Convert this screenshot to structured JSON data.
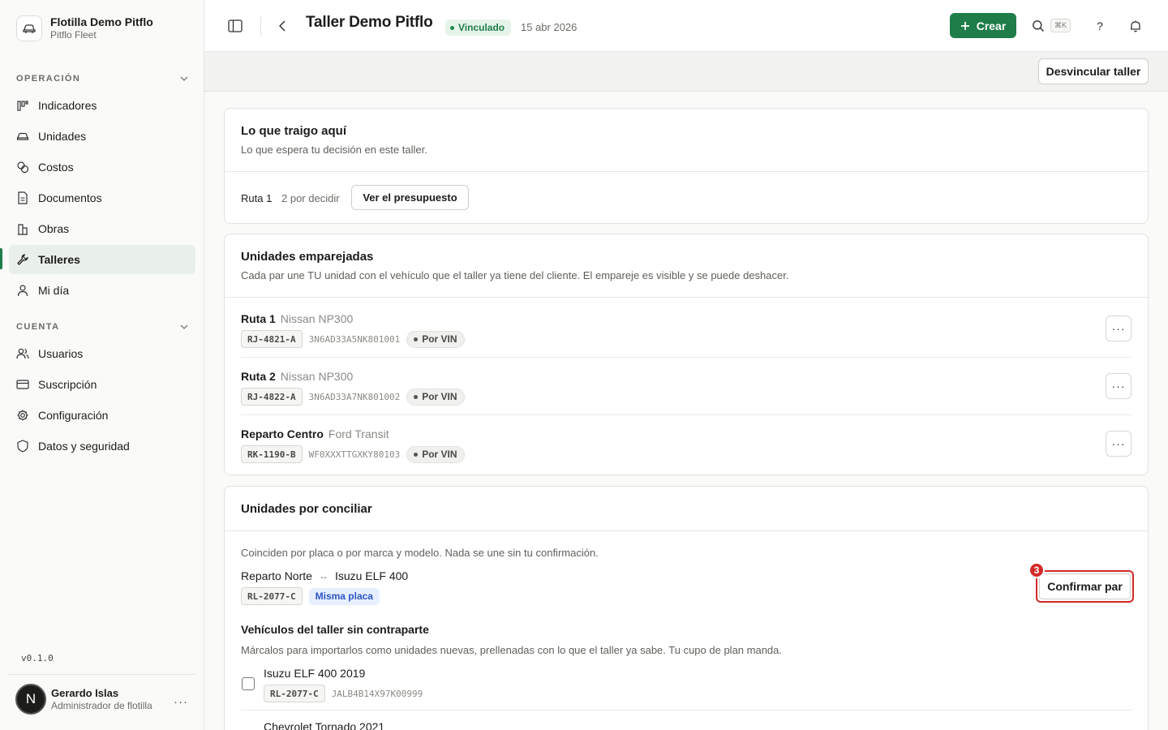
{
  "org": {
    "name": "Flotilla Demo Pitflo",
    "subtitle": "Pitflo Fleet",
    "icon": "car-icon"
  },
  "sidebar": {
    "sections": [
      {
        "label": "OPERACIÓN",
        "items": [
          {
            "label": "Indicadores",
            "icon": "chart-columns-icon"
          },
          {
            "label": "Unidades",
            "icon": "car-icon"
          },
          {
            "label": "Costos",
            "icon": "coins-icon"
          },
          {
            "label": "Documentos",
            "icon": "document-icon"
          },
          {
            "label": "Obras",
            "icon": "building-icon"
          },
          {
            "label": "Talleres",
            "icon": "wrench-icon",
            "active": true
          },
          {
            "label": "Mi día",
            "icon": "user-icon"
          }
        ]
      },
      {
        "label": "CUENTA",
        "items": [
          {
            "label": "Usuarios",
            "icon": "users-icon"
          },
          {
            "label": "Suscripción",
            "icon": "credit-card-icon"
          },
          {
            "label": "Configuración",
            "icon": "gear-icon"
          },
          {
            "label": "Datos y seguridad",
            "icon": "shield-icon"
          }
        ]
      }
    ],
    "version": "v0.1.0",
    "user": {
      "initial": "N",
      "name": "Gerardo Islas",
      "role": "Administrador de flotilla"
    }
  },
  "topbar": {
    "title": "Taller Demo Pitflo",
    "status": "Vinculado",
    "date": "15 abr 2026",
    "create_label": "Crear",
    "shortcut": "⌘K",
    "help": "?"
  },
  "toolbar": {
    "unlink_label": "Desvincular taller"
  },
  "pending": {
    "title": "Lo que traigo aquí",
    "subtitle": "Lo que espera tu decisión en este taller.",
    "route": "Ruta 1",
    "count": "2 por decidir",
    "button": "Ver el presupuesto"
  },
  "paired": {
    "title": "Unidades emparejadas",
    "subtitle": "Cada par une TU unidad con el vehículo que el taller ya tiene del cliente. El empareje es visible y se puede deshacer.",
    "rows": [
      {
        "name": "Ruta 1",
        "model": "Nissan NP300",
        "plate": "RJ-4821-A",
        "vin": "3N6AD33A5NK801001",
        "match": "Por VIN"
      },
      {
        "name": "Ruta 2",
        "model": "Nissan NP300",
        "plate": "RJ-4822-A",
        "vin": "3N6AD33A7NK801002",
        "match": "Por VIN"
      },
      {
        "name": "Reparto Centro",
        "model": "Ford Transit",
        "plate": "RK-1190-B",
        "vin": "WF0XXXTTGXKY80103",
        "match": "Por VIN"
      }
    ]
  },
  "reconcile": {
    "title": "Unidades por conciliar",
    "subtitle": "Coinciden por placa o por marca y modelo. Nada se une sin tu confirmación.",
    "pair": {
      "left": "Reparto Norte",
      "arrow": "↔",
      "right": "Isuzu ELF 400",
      "plate": "RL-2077-C",
      "reason": "Misma placa"
    },
    "confirm_label": "Confirmar par",
    "marker": "3",
    "orphans_title": "Vehículos del taller sin contraparte",
    "orphans_subtitle": "Márcalos para importarlos como unidades nuevas, prellenadas con lo que el taller ya sabe. Tu cupo de plan manda.",
    "orphans": [
      {
        "name": "Isuzu ELF 400 2019",
        "plate": "RL-2077-C",
        "vin": "JALB4B14X97K00999"
      },
      {
        "name": "Chevrolet Tornado 2021"
      }
    ]
  },
  "colors": {
    "brand": "#1e7d49",
    "marker": "#d22a2a",
    "link_blue": "#2b56c9"
  }
}
